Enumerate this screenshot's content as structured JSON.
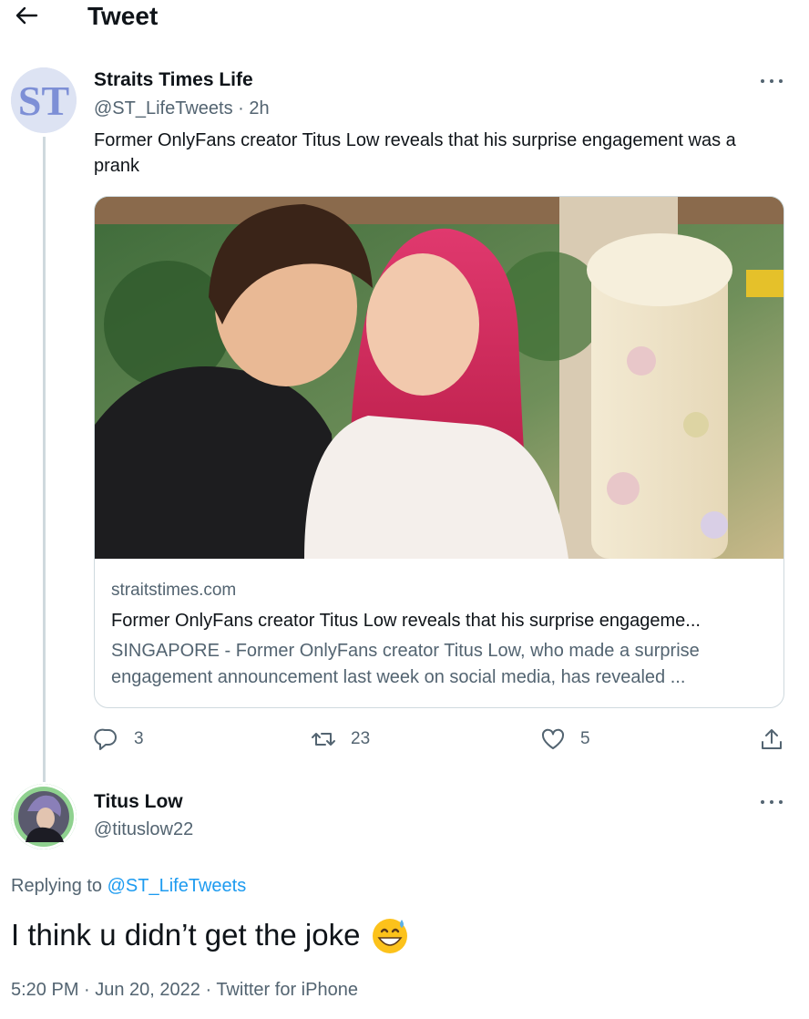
{
  "header": {
    "title": "Tweet"
  },
  "original_tweet": {
    "avatar_text": "ST",
    "name": "Straits Times Life",
    "handle": "@ST_LifeTweets",
    "time": "2h",
    "handle_time": "@ST_LifeTweets · 2h",
    "text": "Former OnlyFans creator Titus Low reveals that his surprise engagement was a prank",
    "card": {
      "domain": "straitstimes.com",
      "title": "Former OnlyFans creator Titus Low reveals that his surprise engageme...",
      "description": "SINGAPORE - Former OnlyFans creator Titus Low, who made a surprise engagement announcement last week on social media, has revealed ..."
    },
    "actions": {
      "replies": "3",
      "retweets": "23",
      "likes": "5"
    }
  },
  "reply_tweet": {
    "name": "Titus Low",
    "handle": "@tituslow22",
    "replying_prefix": "Replying to ",
    "replying_to": "@ST_LifeTweets",
    "text": "I think u didn’t get the joke",
    "emoji": "grinning-face-with-sweat-icon",
    "meta": "5:20 PM · Jun 20, 2022 · Twitter for iPhone"
  },
  "colors": {
    "accent": "#1d9bf0",
    "secondary_text": "#536471",
    "primary_text": "#0f1419",
    "border": "#cfd9de"
  }
}
